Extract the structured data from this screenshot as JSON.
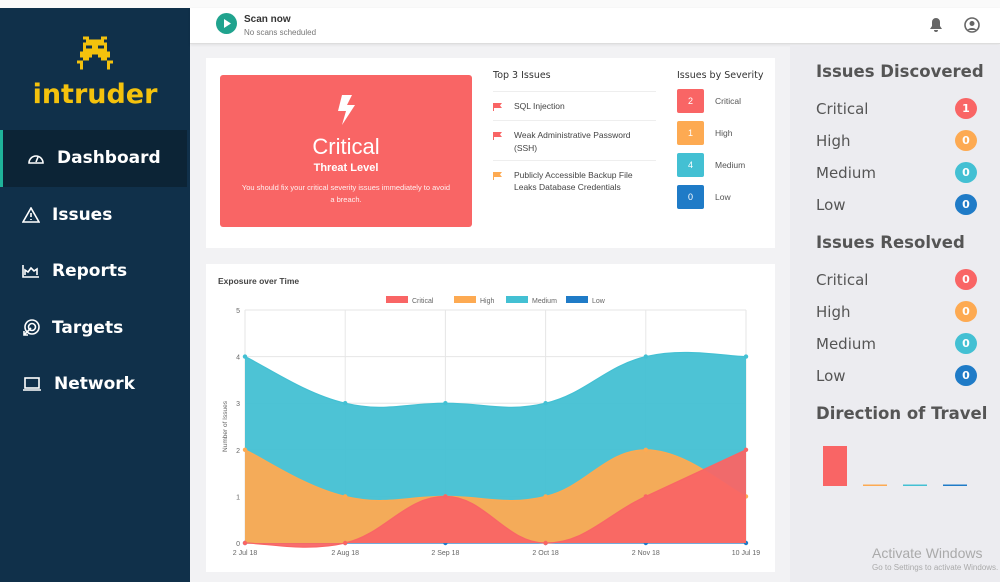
{
  "brand": {
    "name": "intruder",
    "color": "#f4c20d"
  },
  "sidebar": {
    "items": [
      {
        "label": "Dashboard",
        "icon": "gauge-icon",
        "active": true
      },
      {
        "label": "Issues",
        "icon": "warning-icon"
      },
      {
        "label": "Reports",
        "icon": "area-chart-icon"
      },
      {
        "label": "Targets",
        "icon": "target-icon"
      },
      {
        "label": "Network",
        "icon": "laptop-icon"
      }
    ]
  },
  "header": {
    "scan_label": "Scan now",
    "scan_status": "No scans scheduled",
    "icons": [
      "bell-icon",
      "user-icon"
    ]
  },
  "threat": {
    "level": "Critical",
    "label": "Threat Level",
    "message": "You should fix your critical severity issues immediately to avoid a breach.",
    "icon": "lightning-icon"
  },
  "top_issues": {
    "title": "Top 3 Issues",
    "items": [
      {
        "text": "SQL Injection",
        "severity": "critical"
      },
      {
        "text": "Weak Administrative Password (SSH)",
        "severity": "critical"
      },
      {
        "text": "Publicly Accessible Backup File Leaks Database Credentials",
        "severity": "high"
      }
    ]
  },
  "severity": {
    "title": "Issues by Severity",
    "items": [
      {
        "label": "Critical",
        "count": "2"
      },
      {
        "label": "High",
        "count": "1"
      },
      {
        "label": "Medium",
        "count": "4"
      },
      {
        "label": "Low",
        "count": "0"
      }
    ]
  },
  "colors": {
    "critical": "#f96565",
    "high": "#fdaa52",
    "medium": "#43c0d3",
    "low": "#1f7bc7"
  },
  "chart_title": "Exposure over Time",
  "chart_data": [
    {
      "type": "area",
      "title": "Exposure over Time",
      "ylabel": "Number of Issues",
      "xlabel": "",
      "categories": [
        "2 Jul 18",
        "2 Aug 18",
        "2 Sep 18",
        "2 Oct 18",
        "2 Nov 18",
        "10 Jul 19"
      ],
      "ylim": [
        0,
        5
      ],
      "yticks": [
        "0",
        "1",
        "2",
        "3",
        "4",
        "5"
      ],
      "grid": true,
      "legend": "top",
      "stacked": false,
      "series": [
        {
          "name": "Critical",
          "values": [
            0,
            0,
            1,
            0,
            1,
            2
          ]
        },
        {
          "name": "High",
          "values": [
            2,
            1,
            1,
            1,
            2,
            1
          ]
        },
        {
          "name": "Medium",
          "values": [
            4,
            3,
            3,
            3,
            4,
            4
          ]
        },
        {
          "name": "Low",
          "values": [
            0,
            0,
            0,
            0,
            0,
            0
          ]
        }
      ]
    },
    {
      "type": "bar",
      "title": "Direction of Travel",
      "categories": [
        "Critical",
        "High",
        "Medium",
        "Low"
      ],
      "values": [
        1,
        0,
        0,
        0
      ]
    }
  ],
  "right": {
    "discovered": {
      "title": "Issues Discovered",
      "items": [
        {
          "label": "Critical",
          "count": "1"
        },
        {
          "label": "High",
          "count": "0"
        },
        {
          "label": "Medium",
          "count": "0"
        },
        {
          "label": "Low",
          "count": "0"
        }
      ]
    },
    "resolved": {
      "title": "Issues Resolved",
      "items": [
        {
          "label": "Critical",
          "count": "0"
        },
        {
          "label": "High",
          "count": "0"
        },
        {
          "label": "Medium",
          "count": "0"
        },
        {
          "label": "Low",
          "count": "0"
        }
      ]
    },
    "travel_title": "Direction of Travel"
  },
  "watermark": {
    "line1": "Activate Windows",
    "line2": "Go to Settings to activate Windows."
  }
}
